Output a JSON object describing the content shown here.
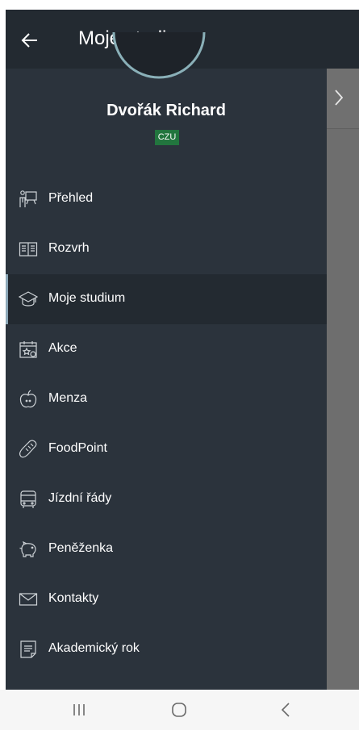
{
  "appbar": {
    "title": "Moje studium"
  },
  "user": {
    "name": "Dvořák Richard",
    "badge": "CZU"
  },
  "menu": [
    {
      "label": "Přehled",
      "icon": "teacher-board-icon",
      "active": false
    },
    {
      "label": "Rozvrh",
      "icon": "open-book-icon",
      "active": false
    },
    {
      "label": "Moje studium",
      "icon": "graduation-cap-icon",
      "active": true
    },
    {
      "label": "Akce",
      "icon": "calendar-star-icon",
      "active": false
    },
    {
      "label": "Menza",
      "icon": "apple-icon",
      "active": false
    },
    {
      "label": "FoodPoint",
      "icon": "baguette-icon",
      "active": false
    },
    {
      "label": "Jízdní řády",
      "icon": "bus-icon",
      "active": false
    },
    {
      "label": "Peněženka",
      "icon": "piggy-bank-icon",
      "active": false
    },
    {
      "label": "Kontakty",
      "icon": "envelope-icon",
      "active": false
    },
    {
      "label": "Akademický rok",
      "icon": "document-icon",
      "active": false
    }
  ],
  "colors": {
    "drawer": "#2b333c",
    "appbar": "#232a31",
    "badge": "#22753e",
    "active_indicator": "#8ca8b8"
  }
}
